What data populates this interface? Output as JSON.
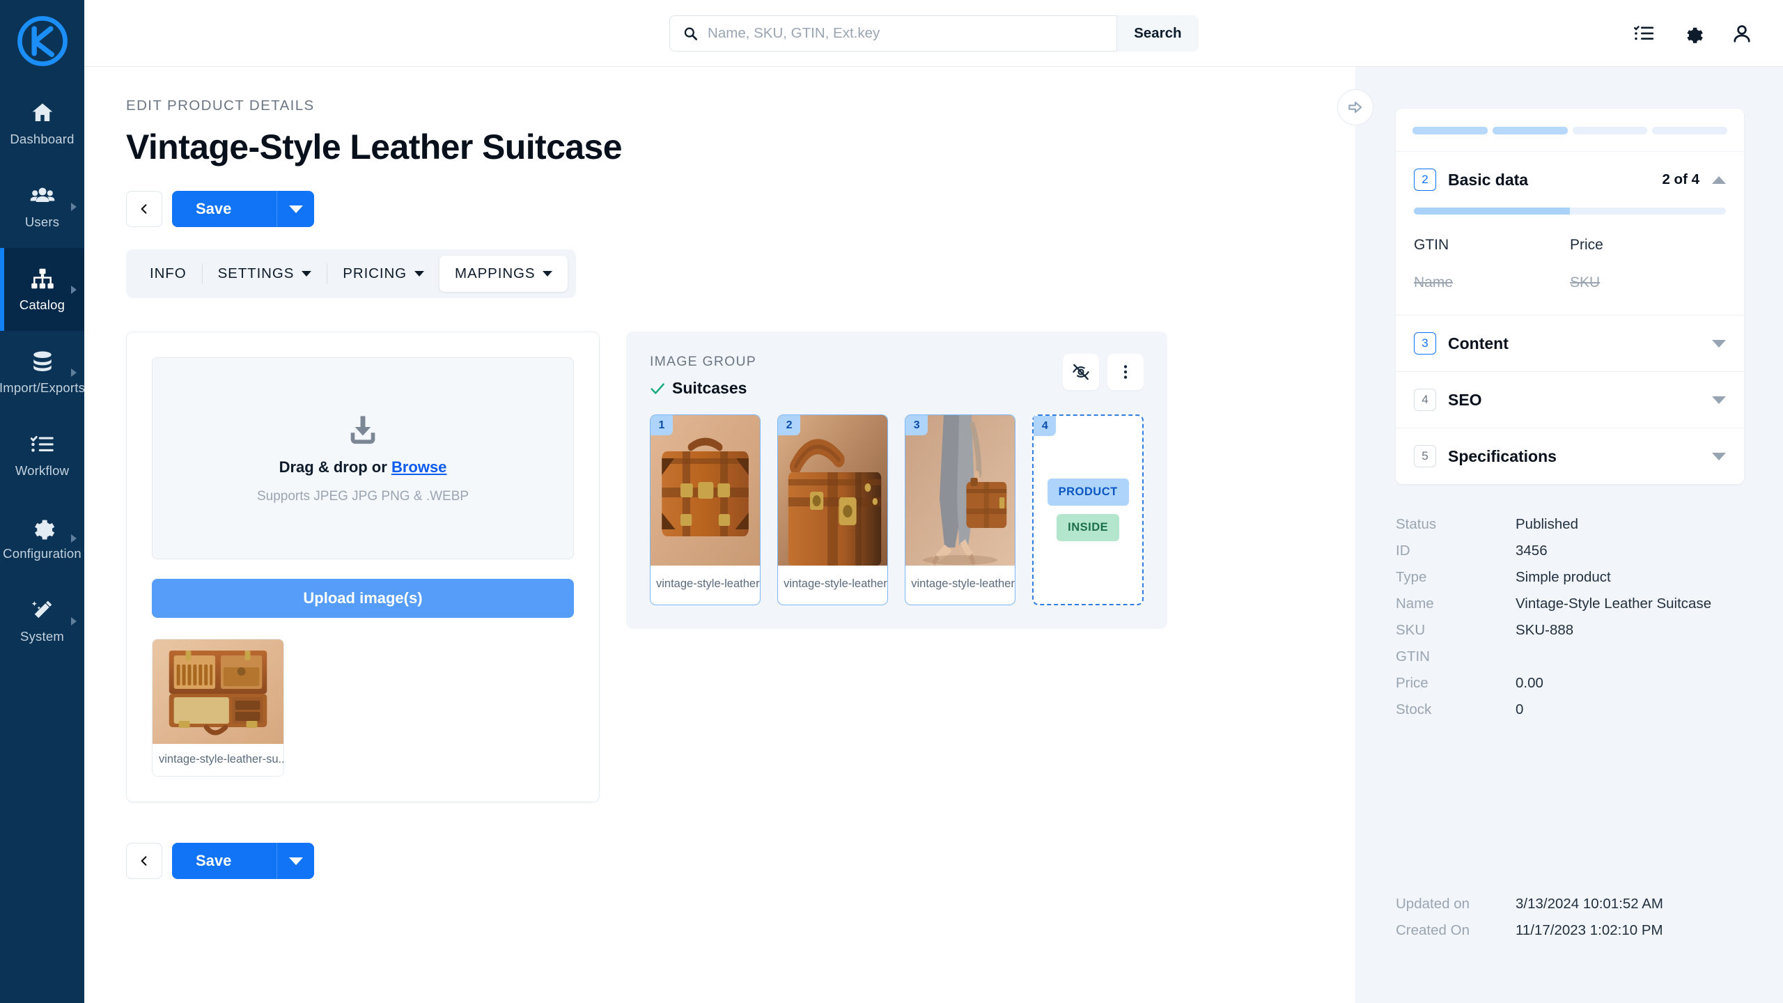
{
  "sidebar": {
    "logo_name": "k-logo",
    "items": [
      {
        "label": "Dashboard",
        "icon": "home-icon",
        "has_children": false,
        "active": false
      },
      {
        "label": "Users",
        "icon": "users-icon",
        "has_children": true,
        "active": false
      },
      {
        "label": "Catalog",
        "icon": "sitemap-icon",
        "has_children": true,
        "active": true
      },
      {
        "label": "Import/Exports",
        "icon": "database-icon",
        "has_children": true,
        "active": false
      },
      {
        "label": "Workflow",
        "icon": "checklist-icon",
        "has_children": false,
        "active": false
      },
      {
        "label": "Configuration",
        "icon": "gear-icon",
        "has_children": true,
        "active": false
      },
      {
        "label": "System",
        "icon": "magic-wand-icon",
        "has_children": true,
        "active": false
      }
    ]
  },
  "topbar": {
    "search_placeholder": "Name, SKU, GTIN, Ext.key",
    "search_value": "",
    "search_button": "Search",
    "icons": [
      "tasks-icon",
      "gear-icon",
      "user-icon"
    ]
  },
  "page": {
    "kicker": "EDIT PRODUCT DETAILS",
    "title": "Vintage-Style Leather Suitcase",
    "save_label": "Save",
    "back_label": "Back"
  },
  "tabs": [
    {
      "label": "INFO",
      "dropdown": false,
      "active": false
    },
    {
      "label": "SETTINGS",
      "dropdown": true,
      "active": false
    },
    {
      "label": "PRICING",
      "dropdown": true,
      "active": false
    },
    {
      "label": "MAPPINGS",
      "dropdown": true,
      "active": true
    }
  ],
  "upload": {
    "dropzone_main_text": "Drag & drop or",
    "dropzone_link": "Browse",
    "dropzone_sub": "Supports JPEG JPG PNG & .WEBP",
    "upload_button": "Upload image(s)",
    "thumbnail": {
      "name": "vintage-style-leather-su...",
      "alt": "open vintage leather suitcase interior"
    }
  },
  "image_group": {
    "kicker": "IMAGE GROUP",
    "title": "Suitcases",
    "status_icon": "check-icon",
    "actions": [
      "eye-off-icon",
      "kebab-menu-icon"
    ],
    "cards": [
      {
        "index": "1",
        "name": "vintage-style-leather-suitca...",
        "alt": "vintage brown leather suitcase front view"
      },
      {
        "index": "2",
        "name": "vintage-style-leather-suitca...",
        "alt": "close-up of leather suitcase handle and latches"
      },
      {
        "index": "3",
        "name": "vintage-style-leather-suitca...",
        "alt": "woman in heels carrying leather briefcase"
      }
    ],
    "drop_target": {
      "index": "4",
      "tags": [
        "PRODUCT",
        "INSIDE"
      ]
    }
  },
  "collapse_button": {
    "icon": "arrow-right-icon"
  },
  "right_panel": {
    "progress_segments": [
      true,
      true,
      false,
      false
    ],
    "sections": [
      {
        "num": "2",
        "title": "Basic data",
        "count": "2 of 4",
        "expanded": true,
        "progress_pct": 50
      },
      {
        "num": "3",
        "title": "Content",
        "count": "",
        "expanded": false
      },
      {
        "num": "4",
        "title": "SEO",
        "count": "",
        "expanded": false
      },
      {
        "num": "5",
        "title": "Specifications",
        "count": "",
        "expanded": false
      }
    ],
    "basic_data_fields": [
      {
        "label": "GTIN",
        "done": false
      },
      {
        "label": "Price",
        "done": false
      },
      {
        "label": "Name",
        "done": true
      },
      {
        "label": "SKU",
        "done": true
      }
    ],
    "meta": [
      {
        "key": "Status",
        "value": "Published"
      },
      {
        "key": "ID",
        "value": "3456"
      },
      {
        "key": "Type",
        "value": "Simple product"
      },
      {
        "key": "Name",
        "value": "Vintage-Style Leather Suitcase"
      },
      {
        "key": "SKU",
        "value": "SKU-888"
      },
      {
        "key": "GTIN",
        "value": ""
      },
      {
        "key": "Price",
        "value": "0.00"
      },
      {
        "key": "Stock",
        "value": "0"
      }
    ],
    "timestamps": [
      {
        "key": "Updated on",
        "value": "3/13/2024 10:01:52 AM"
      },
      {
        "key": "Created On",
        "value": "11/17/2023 1:02:10 PM"
      }
    ]
  },
  "colors": {
    "sidebar_bg": "#0b3355",
    "sidebar_active_bg": "#06294a",
    "accent_blue": "#1173f5",
    "upload_blue": "#559df9",
    "panel_bg": "#f2f6fa",
    "tag_product": "#aed4fb",
    "tag_inside": "#b4e6cd",
    "check_green": "#16a97b"
  }
}
